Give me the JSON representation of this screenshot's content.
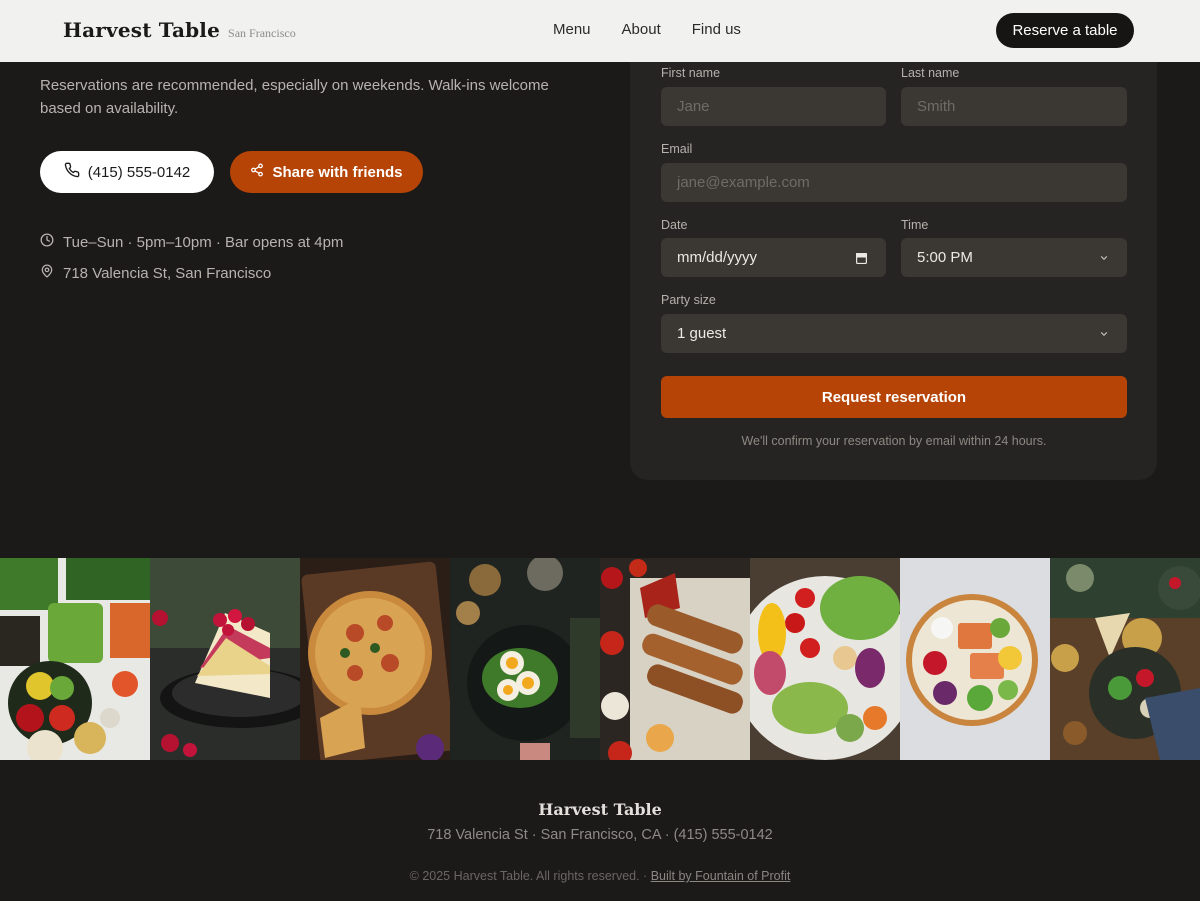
{
  "header": {
    "brand_name": "Harvest Table",
    "brand_city": "San Francisco",
    "nav": [
      "Menu",
      "About",
      "Find us"
    ],
    "cta": "Reserve a table"
  },
  "intro": {
    "text": "Reservations are recommended, especially on weekends. Walk-ins welcome based on availability.",
    "call_label": "(415) 555-0142",
    "share_label": "Share with friends",
    "hours": "Tue–Sun · 5pm–10pm · Bar opens at 4pm",
    "address": "718 Valencia St, San Francisco"
  },
  "form": {
    "first_name_label": "First name",
    "first_name_placeholder": "Jane",
    "last_name_label": "Last name",
    "last_name_placeholder": "Smith",
    "email_label": "Email",
    "email_placeholder": "jane@example.com",
    "date_label": "Date",
    "date_value": "mm/dd/yyyy",
    "time_label": "Time",
    "time_value": "5:00 PM",
    "party_label": "Party size",
    "party_value": "1 guest",
    "submit_label": "Request reservation",
    "note": "We'll confirm your reservation by email within 24 hours."
  },
  "gallery": {
    "photos": [
      "vegetable-platter",
      "berry-cake",
      "pizza",
      "egg-salad-bowl",
      "grilled-skewers",
      "veggie-bowl",
      "salmon-bowl",
      "chickpea-salad"
    ]
  },
  "footer": {
    "name": "Harvest Table",
    "address": "718 Valencia St · San Francisco, CA · (415) 555-0142",
    "copyright": "© 2025 Harvest Table. All rights reserved. ·",
    "credit": "Built by Fountain of Profit"
  },
  "colors": {
    "background": "#1b1a19",
    "card": "#262422",
    "input": "#3b3834",
    "accent": "#b54406",
    "header": "#f1f1f0"
  }
}
